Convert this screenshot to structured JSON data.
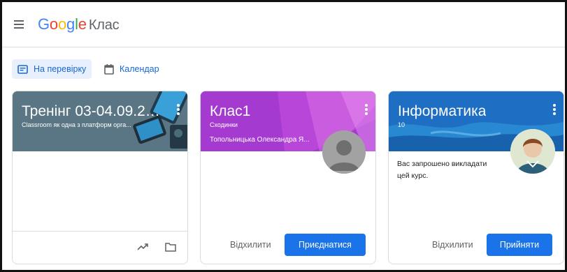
{
  "app": {
    "logo_google": [
      "G",
      "o",
      "o",
      "g",
      "l",
      "e"
    ],
    "product": "Клас"
  },
  "nav": {
    "review_label": "На перевірку",
    "calendar_label": "Календар"
  },
  "colors": {
    "accent": "#1a73e8",
    "nav_bg": "#e8f0fe",
    "card1_banner": "#607d8b",
    "card2_banner": "#9c27b0",
    "card3_banner": "#1e88e5"
  },
  "cards": [
    {
      "title": "Тренінг 03-04.09.20...",
      "subtitle": "Classroom як одна з платформ орга...",
      "icons": [
        "trending-icon",
        "folder-icon"
      ]
    },
    {
      "title": "Клас1",
      "subtitle": "Сходинки",
      "teacher": "Топольницька Олександра Я...",
      "decline_label": "Відхилити",
      "join_label": "Приєднатися"
    },
    {
      "title": "Інформатика",
      "subtitle": "10",
      "invite_text": "Вас запрошено викладати цей курс.",
      "decline_label": "Відхилити",
      "accept_label": "Прийняти"
    }
  ]
}
